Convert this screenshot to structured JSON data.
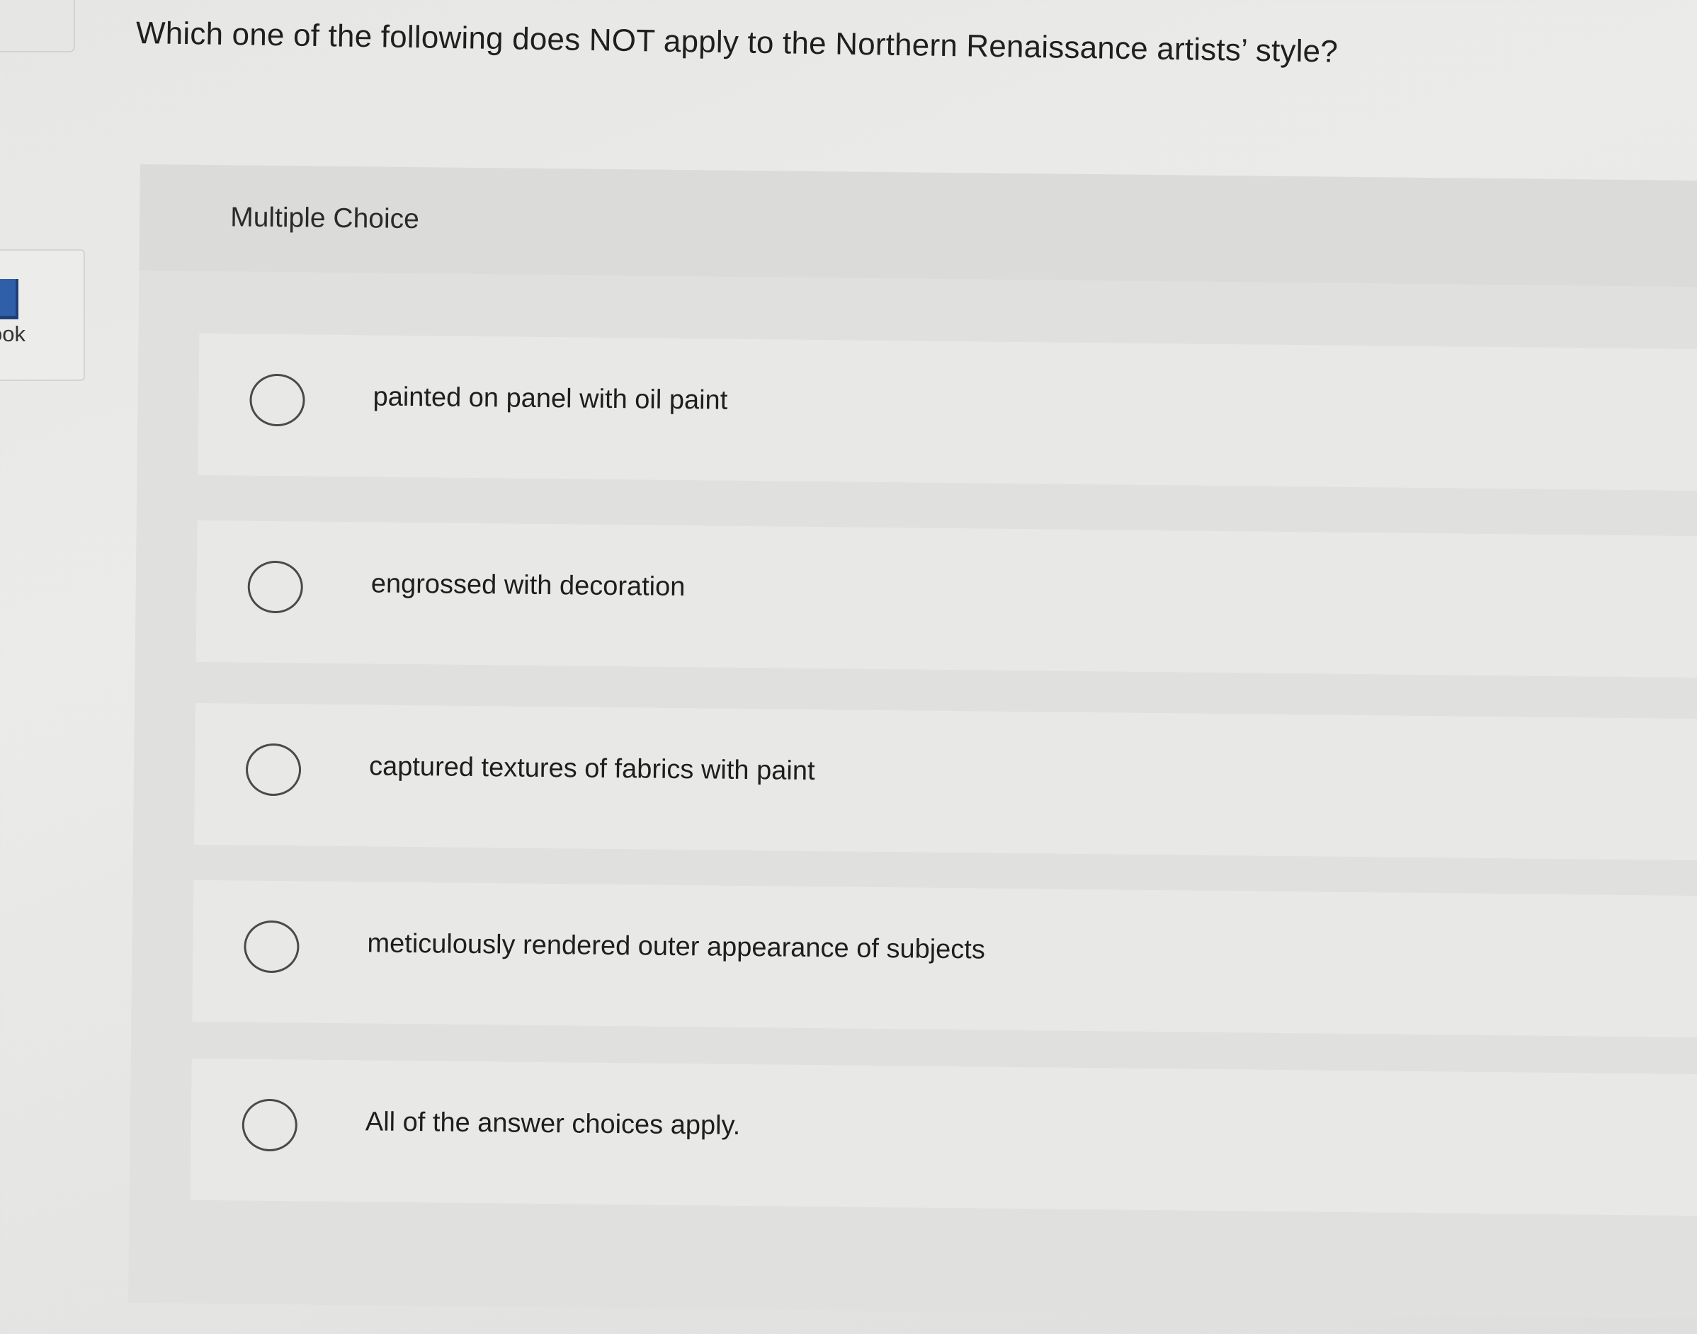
{
  "sidebar": {
    "ebook_label": "ook",
    "ebook_icon": "book-icon"
  },
  "question": {
    "text": "Which one of the following does NOT apply to the Northern Renaissance artists’ style?"
  },
  "multiple_choice": {
    "heading": "Multiple Choice",
    "options": [
      {
        "label": "painted on panel with oil paint",
        "selected": false
      },
      {
        "label": "engrossed with decoration",
        "selected": false
      },
      {
        "label": "captured textures of fabrics with paint",
        "selected": false
      },
      {
        "label": "meticulously rendered outer appearance of subjects",
        "selected": false
      },
      {
        "label": "All of the answer choices apply.",
        "selected": false
      }
    ]
  }
}
